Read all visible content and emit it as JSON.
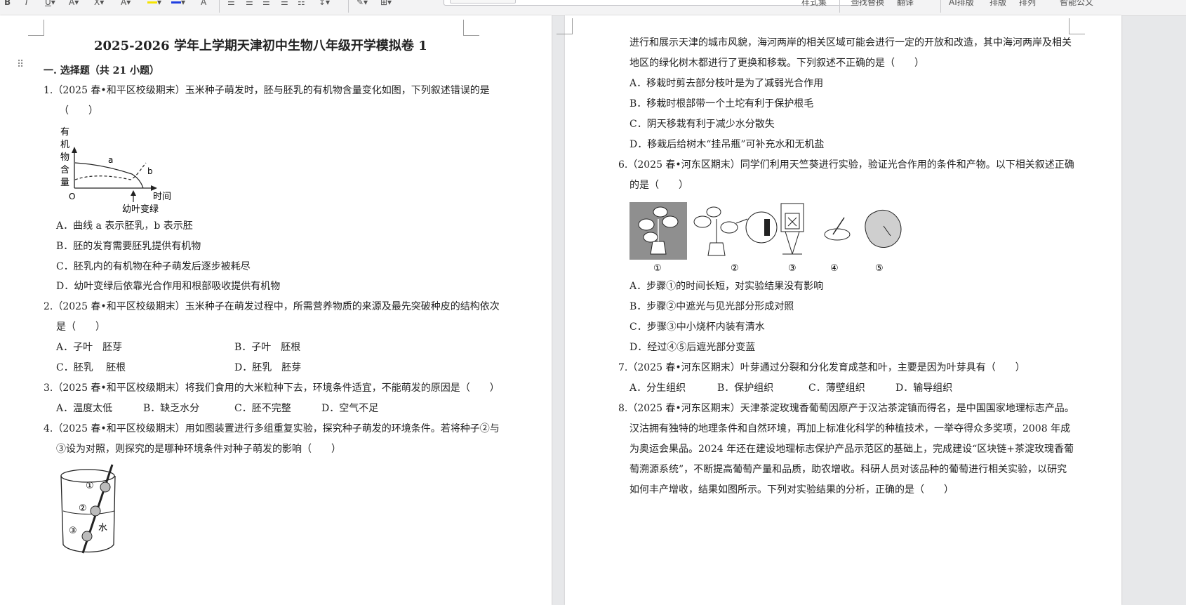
{
  "toolbar": {
    "style_label": "样式集",
    "find_replace_label": "查找替换",
    "translate_label": "翻译",
    "ai_layout_label": "AI排版",
    "layout_label": "排版",
    "arrange_label": "排列",
    "smart_doc_label": "智能公文"
  },
  "doc": {
    "title": "2025-2026 学年上学期天津初中生物八年级开学模拟卷 1",
    "section": "一. 选择题（共 21 小题）",
    "q1": {
      "line1": "1.（2025 春•和平区校级期末）玉米种子萌发时，胚与胚乳的有机物含量变化如图，下列叙述错误的是",
      "line2": "（　　）",
      "chart": {
        "ylabel": [
          "有",
          "机",
          "物",
          "含",
          "量"
        ],
        "origin": "O",
        "xlabel": "时间",
        "curve_a": "a",
        "curve_b": "b",
        "annotation": "幼叶变绿"
      },
      "A": "A．曲线 a 表示胚乳，b 表示胚",
      "B": "B．胚的发育需要胚乳提供有机物",
      "C": "C．胚乳内的有机物在种子萌发后逐步被耗尽",
      "D": "D．幼叶变绿后依靠光合作用和根部吸收提供有机物"
    },
    "q2": {
      "line1": "2.（2025 春•和平区校级期末）玉米种子在萌发过程中，所需营养物质的来源及最先突破种皮的结构依次",
      "line2": "是（　　）",
      "A": "A．子叶　胚芽",
      "B": "B．子叶　胚根",
      "C": "C．胚乳　 胚根",
      "D": "D．胚乳　胚芽"
    },
    "q3": {
      "line1": "3.（2025 春•和平区校级期末）将我们食用的大米粒种下去，环境条件适宜，不能萌发的原因是（　　）",
      "A": "A．温度太低",
      "B": "B．缺乏水分",
      "C": "C．胚不完整",
      "D": "D．空气不足"
    },
    "q4": {
      "line1": "4.（2025 春•和平区校级期末）用如图装置进行多组重复实验，探究种子萌发的环境条件。若将种子②与",
      "line2": "③设为对照，则探究的是哪种环境条件对种子萌发的影响（　　）",
      "labels": [
        "①",
        "②",
        "③"
      ],
      "water": "水"
    },
    "q5": {
      "line1": "进行和展示天津的城市风貌，海河两岸的相关区域可能会进行一定的开放和改造，其中海河两岸及相关",
      "line2": "地区的绿化树木都进行了更换和移栽。下列叙述不正确的是（　　）",
      "A": "A．移栽时剪去部分枝叶是为了减弱光合作用",
      "B": "B．移栽时根部带一个土坨有利于保护根毛",
      "C": "C．阴天移栽有利于减少水分散失",
      "D": "D．移栽后给树木“挂吊瓶”可补充水和无机盐"
    },
    "q6": {
      "line1": "6.（2025 春•河东区期末）同学们利用天竺葵进行实验，验证光合作用的条件和产物。以下相关叙述正确",
      "line2": "的是（　　）",
      "steps": [
        "①",
        "②",
        "③",
        "④",
        "⑤"
      ],
      "A": "A．步骤①的时间长短，对实验结果没有影响",
      "B": "B．步骤②中遮光与见光部分形成对照",
      "C": "C．步骤③中小烧杯内装有清水",
      "D": "D．经过④⑤后遮光部分变蓝"
    },
    "q7": {
      "line1": "7.（2025 春•河东区期末）叶芽通过分裂和分化发育成茎和叶，主要是因为叶芽具有（　　）",
      "A": "A．分生组织",
      "B": "B．保护组织",
      "C": "C．薄壁组织",
      "D": "D．输导组织"
    },
    "q8": {
      "line1": "8.（2025 春•河东区期末）天津茶淀玫瑰香葡萄因原产于汉沽茶淀镇而得名，是中国国家地理标志产品。",
      "line2": "汉沽拥有独特的地理条件和自然环境，再加上标准化科学的种植技术，一举夺得众多奖项，2008 年成",
      "line3": "为奥运会果品。2024 年还在建设地理标志保护产品示范区的基础上，完成建设“区块链+茶淀玫瑰香葡",
      "line4": "萄溯源系统”，不断提高葡萄产量和品质，助农增收。科研人员对该品种的葡萄进行相关实验，以研究",
      "line5": "如何丰产增收，结果如图所示。下列对实验结果的分析，正确的是（　　）"
    }
  }
}
